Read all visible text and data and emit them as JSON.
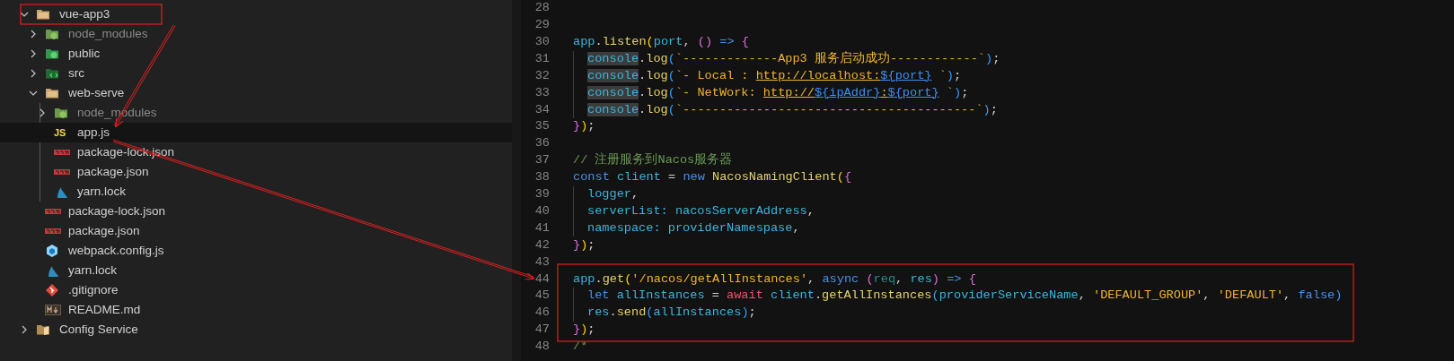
{
  "explorer": {
    "items": [
      {
        "label": "vue-app3",
        "kind": "folder",
        "expanded": true,
        "selected": false,
        "muted": false,
        "children": [
          {
            "label": "node_modules",
            "kind": "node-folder",
            "expanded": false,
            "selected": false,
            "muted": true
          },
          {
            "label": "public",
            "kind": "public-folder",
            "expanded": false,
            "selected": false,
            "muted": false
          },
          {
            "label": "src",
            "kind": "src-folder",
            "expanded": false,
            "selected": false,
            "muted": false
          },
          {
            "label": "web-serve",
            "kind": "folder",
            "expanded": true,
            "selected": false,
            "muted": false,
            "children": [
              {
                "label": "node_modules",
                "kind": "node-folder",
                "expanded": false,
                "selected": false,
                "muted": true
              },
              {
                "label": "app.js",
                "kind": "js",
                "icon_label": "JS",
                "selected": true,
                "muted": false
              },
              {
                "label": "package-lock.json",
                "kind": "npm",
                "selected": false,
                "muted": false
              },
              {
                "label": "package.json",
                "kind": "npm",
                "selected": false,
                "muted": false
              },
              {
                "label": "yarn.lock",
                "kind": "yarn",
                "selected": false,
                "muted": false
              }
            ]
          },
          {
            "label": "package-lock.json",
            "kind": "npm",
            "selected": false,
            "muted": false
          },
          {
            "label": "package.json",
            "kind": "npm",
            "selected": false,
            "muted": false
          },
          {
            "label": "webpack.config.js",
            "kind": "webpack",
            "selected": false,
            "muted": false
          },
          {
            "label": "yarn.lock",
            "kind": "yarn",
            "selected": false,
            "muted": false
          },
          {
            "label": ".gitignore",
            "kind": "git",
            "selected": false,
            "muted": false
          },
          {
            "label": "README.md",
            "kind": "markdown",
            "selected": false,
            "muted": false
          }
        ]
      },
      {
        "label": "Config Service",
        "kind": "config-folder",
        "expanded": false,
        "selected": false,
        "muted": false
      }
    ]
  },
  "editor": {
    "lines": [
      {
        "number": "28"
      },
      {
        "number": "29"
      },
      {
        "number": "30",
        "tokens": [
          {
            "text": "app",
            "kind": "var"
          },
          {
            "text": ".",
            "kind": "punct"
          },
          {
            "text": "listen",
            "kind": "fn"
          },
          {
            "text": "(",
            "kind": "brace1"
          },
          {
            "text": "port",
            "kind": "var"
          },
          {
            "text": ", ",
            "kind": "punct"
          },
          {
            "text": "()",
            "kind": "brace2"
          },
          {
            "text": " =>",
            "kind": "keyword"
          },
          {
            "text": " {",
            "kind": "brace2"
          }
        ]
      },
      {
        "number": "31",
        "indented": true,
        "tokens": [
          {
            "text": "console",
            "kind": "highlight"
          },
          {
            "text": ".",
            "kind": "punct"
          },
          {
            "text": "log",
            "kind": "fn"
          },
          {
            "text": "(",
            "kind": "brace3"
          },
          {
            "text": "`-------------App3 服务启动成功------------`",
            "kind": "string"
          },
          {
            "text": ")",
            "kind": "brace3"
          },
          {
            "text": ";",
            "kind": "punct"
          }
        ]
      },
      {
        "number": "32",
        "indented": true,
        "tokens": [
          {
            "text": "console",
            "kind": "highlight"
          },
          {
            "text": ".",
            "kind": "punct"
          },
          {
            "text": "log",
            "kind": "fn"
          },
          {
            "text": "(",
            "kind": "brace3"
          },
          {
            "text": "`- Local : ",
            "kind": "string"
          },
          {
            "text": "http://localhost:",
            "kind": "link"
          },
          {
            "text": "${port}",
            "kind": "interp"
          },
          {
            "text": " `",
            "kind": "string"
          },
          {
            "text": ")",
            "kind": "brace3"
          },
          {
            "text": ";",
            "kind": "punct"
          }
        ]
      },
      {
        "number": "33",
        "indented": true,
        "tokens": [
          {
            "text": "console",
            "kind": "highlight"
          },
          {
            "text": ".",
            "kind": "punct"
          },
          {
            "text": "log",
            "kind": "fn"
          },
          {
            "text": "(",
            "kind": "brace3"
          },
          {
            "text": "`- NetWork: ",
            "kind": "string"
          },
          {
            "text": "http://",
            "kind": "link"
          },
          {
            "text": "${ipAddr}",
            "kind": "interp"
          },
          {
            "text": ":",
            "kind": "link"
          },
          {
            "text": "${port}",
            "kind": "interp"
          },
          {
            "text": " `",
            "kind": "string"
          },
          {
            "text": ")",
            "kind": "brace3"
          },
          {
            "text": ";",
            "kind": "punct"
          }
        ]
      },
      {
        "number": "34",
        "indented": true,
        "tokens": [
          {
            "text": "console",
            "kind": "highlight"
          },
          {
            "text": ".",
            "kind": "punct"
          },
          {
            "text": "log",
            "kind": "fn"
          },
          {
            "text": "(",
            "kind": "brace3"
          },
          {
            "text": "`----------------------------------------`",
            "kind": "string"
          },
          {
            "text": ")",
            "kind": "brace3"
          },
          {
            "text": ";",
            "kind": "punct"
          }
        ]
      },
      {
        "number": "35",
        "tokens": [
          {
            "text": "}",
            "kind": "brace2"
          },
          {
            "text": ")",
            "kind": "brace1"
          },
          {
            "text": ";",
            "kind": "punct"
          }
        ]
      },
      {
        "number": "36"
      },
      {
        "number": "37",
        "tokens": [
          {
            "text": "// 注册服务到Nacos服务器",
            "kind": "comment"
          }
        ]
      },
      {
        "number": "38",
        "tokens": [
          {
            "text": "const",
            "kind": "keyword"
          },
          {
            "text": " client",
            "kind": "var"
          },
          {
            "text": " = ",
            "kind": "punct"
          },
          {
            "text": "new",
            "kind": "keyword"
          },
          {
            "text": " NacosNamingClient",
            "kind": "fn"
          },
          {
            "text": "(",
            "kind": "brace1"
          },
          {
            "text": "{",
            "kind": "brace2"
          }
        ]
      },
      {
        "number": "39",
        "indented": true,
        "tokens": [
          {
            "text": "logger",
            "kind": "var"
          },
          {
            "text": ",",
            "kind": "punct"
          }
        ]
      },
      {
        "number": "40",
        "indented": true,
        "tokens": [
          {
            "text": "serverList:",
            "kind": "var"
          },
          {
            "text": " nacosServerAddress",
            "kind": "var"
          },
          {
            "text": ",",
            "kind": "punct"
          }
        ]
      },
      {
        "number": "41",
        "indented": true,
        "tokens": [
          {
            "text": "namespace:",
            "kind": "var"
          },
          {
            "text": " providerNamespase",
            "kind": "var"
          },
          {
            "text": ",",
            "kind": "punct"
          }
        ]
      },
      {
        "number": "42",
        "tokens": [
          {
            "text": "}",
            "kind": "brace2"
          },
          {
            "text": ")",
            "kind": "brace1"
          },
          {
            "text": ";",
            "kind": "punct"
          }
        ]
      },
      {
        "number": "43"
      },
      {
        "number": "44",
        "tokens": [
          {
            "text": "app",
            "kind": "var"
          },
          {
            "text": ".",
            "kind": "punct"
          },
          {
            "text": "get",
            "kind": "fn"
          },
          {
            "text": "(",
            "kind": "brace1"
          },
          {
            "text": "'/nacos/getAllInstances'",
            "kind": "string"
          },
          {
            "text": ", ",
            "kind": "punct"
          },
          {
            "text": "async",
            "kind": "keyword"
          },
          {
            "text": " (",
            "kind": "brace2"
          },
          {
            "text": "req",
            "kind": "param"
          },
          {
            "text": ", ",
            "kind": "punct"
          },
          {
            "text": "res",
            "kind": "var"
          },
          {
            "text": ")",
            "kind": "brace2"
          },
          {
            "text": " =>",
            "kind": "keyword"
          },
          {
            "text": " {",
            "kind": "brace2"
          }
        ]
      },
      {
        "number": "45",
        "indented": true,
        "tokens": [
          {
            "text": "let",
            "kind": "keyword"
          },
          {
            "text": " allInstances",
            "kind": "var"
          },
          {
            "text": " = ",
            "kind": "punct"
          },
          {
            "text": "await",
            "kind": "control"
          },
          {
            "text": " client",
            "kind": "var"
          },
          {
            "text": ".",
            "kind": "punct"
          },
          {
            "text": "getAllInstances",
            "kind": "fn"
          },
          {
            "text": "(",
            "kind": "brace3"
          },
          {
            "text": "providerServiceName",
            "kind": "var"
          },
          {
            "text": ", ",
            "kind": "punct"
          },
          {
            "text": "'DEFAULT_GROUP'",
            "kind": "string"
          },
          {
            "text": ", ",
            "kind": "punct"
          },
          {
            "text": "'DEFAULT'",
            "kind": "string"
          },
          {
            "text": ", ",
            "kind": "punct"
          },
          {
            "text": "false",
            "kind": "keyword"
          },
          {
            "text": ")",
            "kind": "brace3"
          }
        ]
      },
      {
        "number": "46",
        "indented": true,
        "tokens": [
          {
            "text": "res",
            "kind": "var"
          },
          {
            "text": ".",
            "kind": "punct"
          },
          {
            "text": "send",
            "kind": "fn"
          },
          {
            "text": "(",
            "kind": "brace3"
          },
          {
            "text": "allInstances",
            "kind": "var"
          },
          {
            "text": ")",
            "kind": "brace3"
          },
          {
            "text": ";",
            "kind": "punct"
          }
        ]
      },
      {
        "number": "47",
        "tokens": [
          {
            "text": "}",
            "kind": "brace2"
          },
          {
            "text": ")",
            "kind": "brace1"
          },
          {
            "text": ";",
            "kind": "punct"
          }
        ]
      },
      {
        "number": "48",
        "tokens": [
          {
            "text": "/*",
            "kind": "comment"
          }
        ]
      }
    ]
  }
}
